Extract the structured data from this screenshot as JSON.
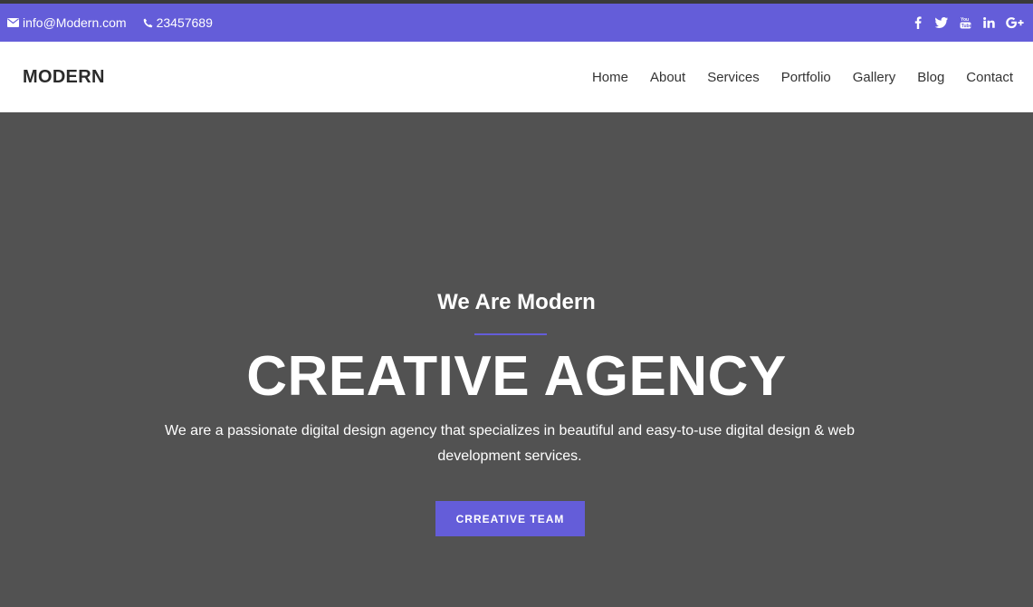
{
  "topbar": {
    "email": "info@Modern.com",
    "phone": "23457689",
    "social": [
      "facebook-icon",
      "twitter-icon",
      "youtube-icon",
      "linkedin-icon",
      "google-plus-icon"
    ],
    "color": "#645dd9"
  },
  "navbar": {
    "brand": "MODERN",
    "links": [
      "Home",
      "About",
      "Services",
      "Portfolio",
      "Gallery",
      "Blog",
      "Contact"
    ]
  },
  "hero": {
    "subtitle": "We Are Modern",
    "title": "CREATIVE AGENCY",
    "description": "We are a passionate digital design agency that specializes in beautiful and easy-to-use digital design & web development services.",
    "button": "CRREATIVE TEAM",
    "background": "#525252"
  }
}
